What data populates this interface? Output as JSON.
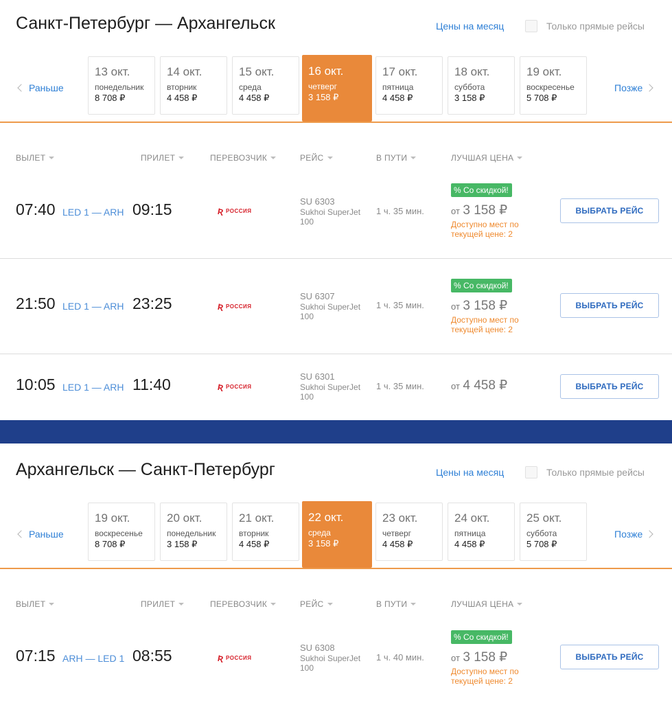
{
  "sections": [
    {
      "title": "Санкт-Петербург — Архангельск",
      "month_link": "Цены на месяц",
      "direct_label": "Только прямые рейсы",
      "nav_prev": "Раньше",
      "nav_next": "Позже",
      "dates": [
        {
          "date": "13 окт.",
          "weekday": "понедельник",
          "price": "8 708 ₽",
          "active": false
        },
        {
          "date": "14 окт.",
          "weekday": "вторник",
          "price": "4 458 ₽",
          "active": false
        },
        {
          "date": "15 окт.",
          "weekday": "среда",
          "price": "4 458 ₽",
          "active": false
        },
        {
          "date": "16 окт.",
          "weekday": "четверг",
          "price": "3 158 ₽",
          "active": true
        },
        {
          "date": "17 окт.",
          "weekday": "пятница",
          "price": "4 458 ₽",
          "active": false
        },
        {
          "date": "18 окт.",
          "weekday": "суббота",
          "price": "3 158 ₽",
          "active": false
        },
        {
          "date": "19 окт.",
          "weekday": "воскресенье",
          "price": "5 708 ₽",
          "active": false
        }
      ],
      "headers": {
        "dep": "ВЫЛЕТ",
        "arr": "ПРИЛЕТ",
        "carrier": "ПЕРЕВОЗЧИК",
        "flight": "РЕЙС",
        "duration": "В ПУТИ",
        "price": "ЛУЧШАЯ ЦЕНА"
      },
      "flights": [
        {
          "dep": "07:40",
          "route": "LED 1 — ARH",
          "arr": "09:15",
          "airline": "РОССИЯ",
          "flight_no": "SU 6303",
          "aircraft": "Sukhoi SuperJet 100",
          "duration": "1 ч. 35 мин.",
          "badge": "% Со скидкой!",
          "price_from": "от",
          "price": "3 158 ₽",
          "availability": "Доступно мест по текущей цене: 2",
          "button": "ВЫБРАТЬ РЕЙС"
        },
        {
          "dep": "21:50",
          "route": "LED 1 — ARH",
          "arr": "23:25",
          "airline": "РОССИЯ",
          "flight_no": "SU 6307",
          "aircraft": "Sukhoi SuperJet 100",
          "duration": "1 ч. 35 мин.",
          "badge": "% Со скидкой!",
          "price_from": "от",
          "price": "3 158 ₽",
          "availability": "Доступно мест по текущей цене: 2",
          "button": "ВЫБРАТЬ РЕЙС"
        },
        {
          "dep": "10:05",
          "route": "LED 1 — ARH",
          "arr": "11:40",
          "airline": "РОССИЯ",
          "flight_no": "SU 6301",
          "aircraft": "Sukhoi SuperJet 100",
          "duration": "1 ч. 35 мин.",
          "badge": "",
          "price_from": "от",
          "price": "4 458 ₽",
          "availability": "",
          "button": "ВЫБРАТЬ РЕЙС"
        }
      ]
    },
    {
      "title": "Архангельск — Санкт-Петербург",
      "month_link": "Цены на месяц",
      "direct_label": "Только прямые рейсы",
      "nav_prev": "Раньше",
      "nav_next": "Позже",
      "dates": [
        {
          "date": "19 окт.",
          "weekday": "воскресенье",
          "price": "8 708 ₽",
          "active": false
        },
        {
          "date": "20 окт.",
          "weekday": "понедельник",
          "price": "3 158 ₽",
          "active": false
        },
        {
          "date": "21 окт.",
          "weekday": "вторник",
          "price": "4 458 ₽",
          "active": false
        },
        {
          "date": "22 окт.",
          "weekday": "среда",
          "price": "3 158 ₽",
          "active": true
        },
        {
          "date": "23 окт.",
          "weekday": "четверг",
          "price": "4 458 ₽",
          "active": false
        },
        {
          "date": "24 окт.",
          "weekday": "пятница",
          "price": "4 458 ₽",
          "active": false
        },
        {
          "date": "25 окт.",
          "weekday": "суббота",
          "price": "5 708 ₽",
          "active": false
        }
      ],
      "headers": {
        "dep": "ВЫЛЕТ",
        "arr": "ПРИЛЕТ",
        "carrier": "ПЕРЕВОЗЧИК",
        "flight": "РЕЙС",
        "duration": "В ПУТИ",
        "price": "ЛУЧШАЯ ЦЕНА"
      },
      "flights": [
        {
          "dep": "07:15",
          "route": "ARH — LED 1",
          "arr": "08:55",
          "airline": "РОССИЯ",
          "flight_no": "SU 6308",
          "aircraft": "Sukhoi SuperJet 100",
          "duration": "1 ч. 40 мин.",
          "badge": "% Со скидкой!",
          "price_from": "от",
          "price": "3 158 ₽",
          "availability": "Доступно мест по текущей цене: 2",
          "button": "ВЫБРАТЬ РЕЙС"
        }
      ]
    }
  ],
  "colors": {
    "accent_orange": "#e9893a",
    "link_blue": "#2f80d6",
    "discount_green": "#47b865",
    "availability_orange": "#ef8a2f",
    "divider_blue": "#1f3f8a"
  }
}
